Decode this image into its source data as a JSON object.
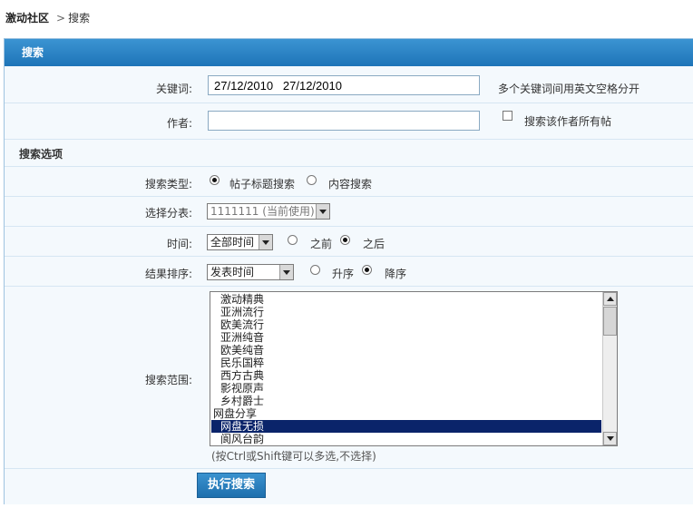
{
  "breadcrumb": {
    "home": "激动社区",
    "separator": ">",
    "current": "搜索"
  },
  "panel": {
    "title": "搜索"
  },
  "keyword": {
    "label": "关键词:",
    "value": "27/12/2010   27/12/2010",
    "hint": "多个关键词间用英文空格分开"
  },
  "author": {
    "label": "作者:",
    "value": "",
    "checkbox_label": "搜索该作者所有帖",
    "checked": false
  },
  "options": {
    "title": "搜索选项"
  },
  "search_type": {
    "label": "搜索类型:",
    "option_title": "帖子标题搜索",
    "option_content": "内容搜索",
    "selected": "帖子标题搜索"
  },
  "category": {
    "label": "选择分表:",
    "selected": "1111111 (当前使用)"
  },
  "time": {
    "label": "时间:",
    "selected": "全部时间",
    "before": "之前",
    "after": "之后",
    "selected_direction": "之后"
  },
  "sort": {
    "label": "结果排序:",
    "selected": "发表时间",
    "asc": "升序",
    "desc": "降序",
    "selected_order": "降序"
  },
  "scope": {
    "label": "搜索范围:",
    "items": [
      {
        "text": "激动精典",
        "kind": "sub"
      },
      {
        "text": "亚洲流行",
        "kind": "sub"
      },
      {
        "text": "欧美流行",
        "kind": "sub"
      },
      {
        "text": "亚洲纯音",
        "kind": "sub"
      },
      {
        "text": "欧美纯音",
        "kind": "sub"
      },
      {
        "text": "民乐国粹",
        "kind": "sub"
      },
      {
        "text": "西方古典",
        "kind": "sub"
      },
      {
        "text": "影视原声",
        "kind": "sub"
      },
      {
        "text": "乡村爵士",
        "kind": "sub"
      },
      {
        "text": "网盘分享",
        "kind": "group"
      },
      {
        "text": "网盘无损",
        "kind": "sub",
        "selected": true
      },
      {
        "text": "阆风台韵",
        "kind": "sub"
      }
    ],
    "tip": "(按Ctrl或Shift键可以多选,不选择)"
  },
  "submit": {
    "label": "执行搜索"
  },
  "colors": {
    "header_blue": "#1e74b8",
    "row_bg": "#f4f9fd",
    "selection": "#0a246a"
  }
}
